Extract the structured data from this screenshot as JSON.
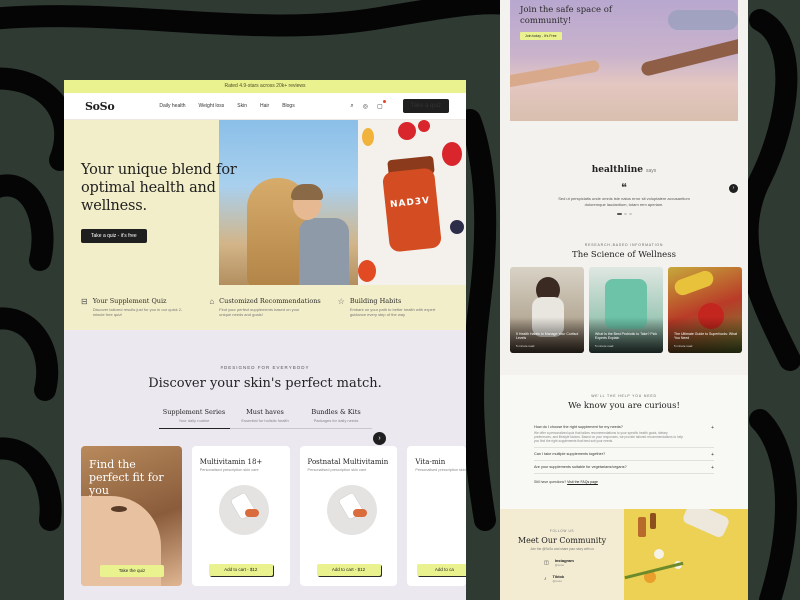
{
  "announcement": "Rated 4.9-stars across 20k+ reviews",
  "brand": "SoSo",
  "nav": {
    "links": [
      "Daily health",
      "Weight loss",
      "Skin",
      "Hair",
      "Blogs"
    ],
    "quiz_button": "Take a quiz",
    "icons": [
      "search-icon",
      "account-icon",
      "cart-icon"
    ]
  },
  "hero": {
    "title": "Your unique blend for optimal health and wellness.",
    "cta": "Take a quiz - it's free",
    "bottle_label": "NAD3V"
  },
  "features": [
    {
      "icon": "quiz-icon",
      "title": "Your Supplement Quiz",
      "desc": "Discover tailored results just for you in our quick 2-minute free quiz!"
    },
    {
      "icon": "store-icon",
      "title": "Customized Recommendations",
      "desc": "Find your perfect supplements based on your unique needs and goals!"
    },
    {
      "icon": "star-icon",
      "title": "Building Habits",
      "desc": "Embark on your path to better health with expert guidance every step of the way"
    }
  ],
  "discover": {
    "eyebrow": "#DESIGNED FOR EVERYBODY",
    "title": "Discover your skin's perfect match.",
    "tabs": [
      {
        "label": "Supplement Series",
        "sub": "Your daily routine"
      },
      {
        "label": "Must haves",
        "sub": "Essential for holistic health"
      },
      {
        "label": "Bundles & Kits",
        "sub": "Packages for daily needs"
      }
    ],
    "promo": {
      "title": "Find the perfect fit for you",
      "button": "Take the quiz"
    },
    "products": [
      {
        "name": "Multivitamin 18+",
        "sub": "Personalised prescription skin care",
        "button": "Add to cart - $12"
      },
      {
        "name": "Postnatal Multivitamin",
        "sub": "Personalised prescription skin care",
        "button": "Add to cart - $12"
      },
      {
        "name": "Vita-min",
        "sub": "Personalised prescription skin care",
        "button": "Add to ca"
      }
    ]
  },
  "community_hero": {
    "title": "Join the safe space of community!",
    "button": "Join today - It's Free"
  },
  "testimonial": {
    "brand": "healthline",
    "says": "says",
    "quote": "Sed ut perspiciatis unde omnis iste natus error sit voluptatem accusantium doloremque laudantium, totam rem aperiam."
  },
  "science": {
    "eyebrow": "RESEARCH-BASED INFORMATION",
    "title": "The Science of Wellness",
    "cards": [
      {
        "title": "5 Health Habits to Manage Your Cortisol Levels",
        "meta": "5 minute read"
      },
      {
        "title": "What Is the Best Probiotic to Take? Pick Experts Explain",
        "meta": "5 minute read"
      },
      {
        "title": "The Ultimate Guide to Superfoods: What You Need",
        "meta": "5 minute read"
      }
    ]
  },
  "faq": {
    "eyebrow": "WE'LL THE HELP YOU NEED",
    "title": "We know you are curious!",
    "items": [
      {
        "q": "How do I choose the right supplement for my needs?",
        "a": "We offer a personalized quiz that tailors recommendations to your specific health goals, dietary preferences, and lifestyle factors. Based on your responses, we provide tailored recommendations to help you find the right supplements that best suit your needs."
      },
      {
        "q": "Can I take multiple supplements together?",
        "a": ""
      },
      {
        "q": "Are your supplements suitable for vegetarians/vegans?",
        "a": ""
      }
    ],
    "more_prefix": "Still have questions?",
    "more_link": "Visit the FAQs page"
  },
  "community_bottom": {
    "eyebrow": "FOLLOW US",
    "title": "Meet Our Community",
    "sub": "Join the @SoSo and share your story with us",
    "socials": [
      {
        "icon": "instagram-icon",
        "name": "Instagram",
        "handle": "@soso"
      },
      {
        "icon": "tiktok-icon",
        "name": "Tiktok",
        "handle": "@soso"
      }
    ]
  }
}
